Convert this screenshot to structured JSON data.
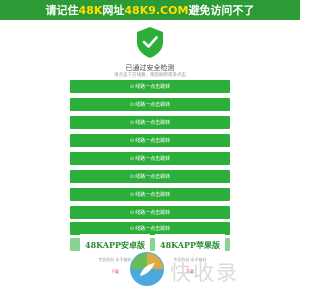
{
  "banner": {
    "prefix": "请记住",
    "domain1": "48K",
    "mid": "网址 ",
    "domain2": "48K9.COM",
    "suffix": " 避免访问不了"
  },
  "verify": {
    "title": "已通过安全检测",
    "subtitle": "请点击下方线路，稍后刷新或多点击"
  },
  "buttons": [
    {
      "label": "线路一点击跳转"
    },
    {
      "label": "线路一点击跳转"
    },
    {
      "label": "线路一点击跳转"
    },
    {
      "label": "线路一点击跳转"
    },
    {
      "label": "线路一点击跳转"
    },
    {
      "label": "线路一点击跳转"
    },
    {
      "label": "线路一点击跳转"
    },
    {
      "label": "线路一点击跳转"
    },
    {
      "label": "线路一点击跳转"
    },
    {
      "label": ""
    }
  ],
  "apps": {
    "android": {
      "title": "48KAPP安卓版",
      "subtitle": "专业防封 永不被封",
      "download": "下载"
    },
    "ios": {
      "title": "48KAPP苹果版",
      "subtitle": "专业防封 永不被封",
      "download": "下载"
    }
  },
  "watermark": {
    "text": "快收录"
  },
  "colors": {
    "banner": "#2c9a35",
    "highlight": "#ffe100",
    "button": "#2bae3a",
    "shield": "#2bae3a"
  },
  "icons": {
    "shield": "shield-check-icon",
    "arrow": "arrow-circle-icon"
  }
}
